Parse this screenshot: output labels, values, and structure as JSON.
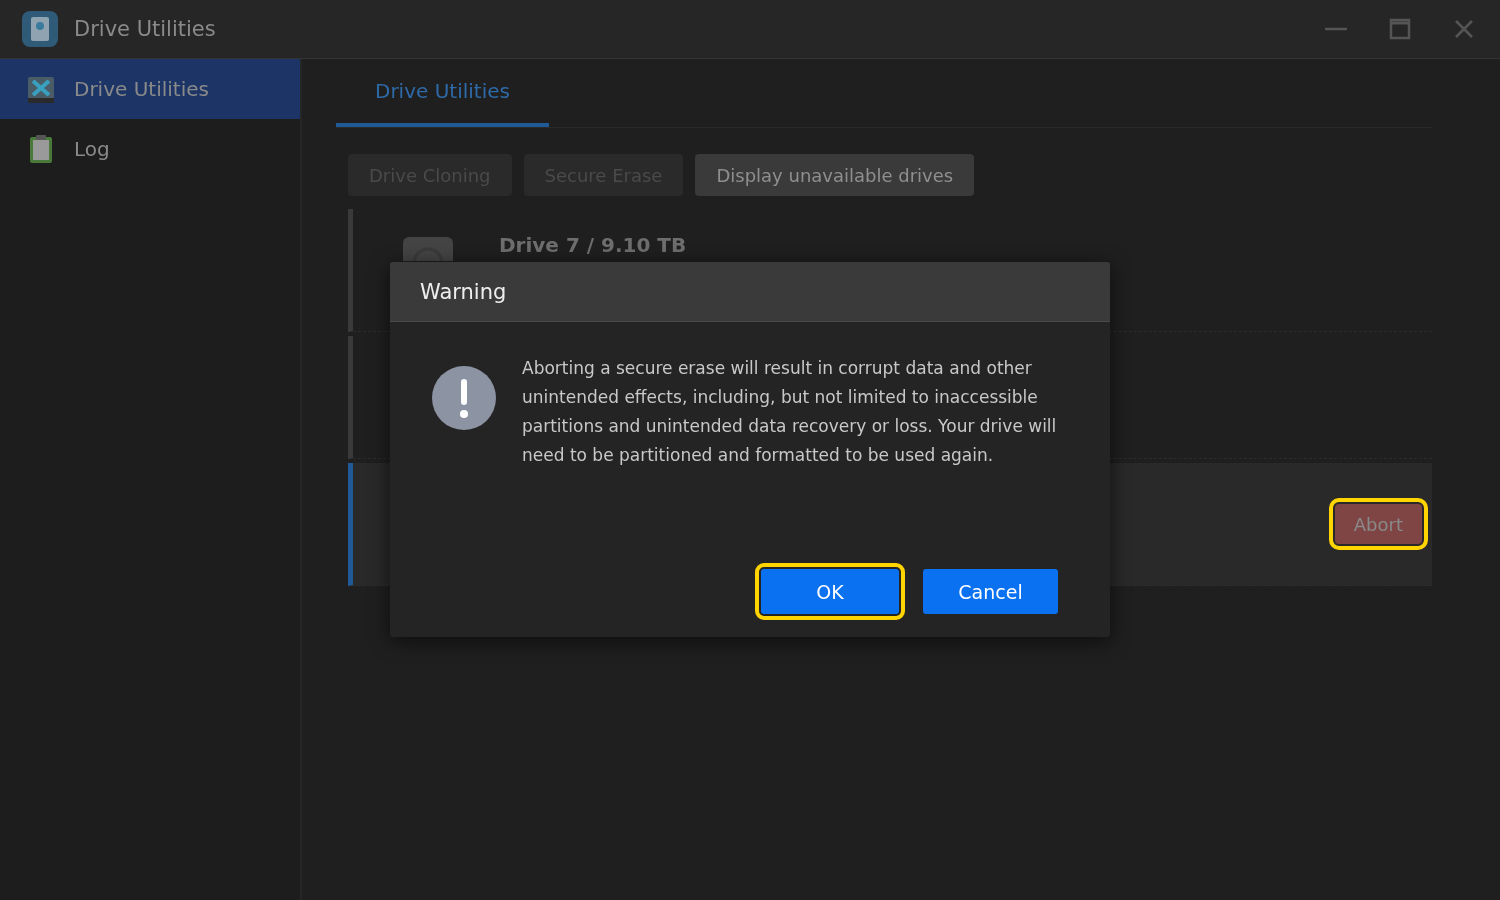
{
  "window": {
    "title": "Drive Utilities"
  },
  "sidebar": {
    "items": [
      {
        "label": "Drive Utilities",
        "kind": "tools",
        "selected": true
      },
      {
        "label": "Log",
        "kind": "clipboard",
        "selected": false
      }
    ]
  },
  "tabs": [
    {
      "label": "Drive Utilities",
      "selected": true
    }
  ],
  "toolbar": [
    {
      "label": "Drive Cloning",
      "disabled": true
    },
    {
      "label": "Secure Erase",
      "disabled": true
    },
    {
      "label": "Display unavailable drives",
      "disabled": false
    }
  ],
  "drives": [
    {
      "title": "Drive 7 / 9.10 TB",
      "selected": false
    },
    {
      "selected": false
    },
    {
      "selected": true,
      "action": {
        "label": "Abort",
        "highlighted": true
      }
    }
  ],
  "dialog": {
    "title": "Warning",
    "message": "Aborting a secure erase will result in corrupt data and other unintended effects, including, but not limited to inaccessible partitions and unintended data recovery or loss. Your drive will need to be partitioned and formatted to be used again.",
    "buttons": [
      {
        "label": "OK",
        "highlighted": true
      },
      {
        "label": "Cancel",
        "highlighted": false
      }
    ]
  }
}
